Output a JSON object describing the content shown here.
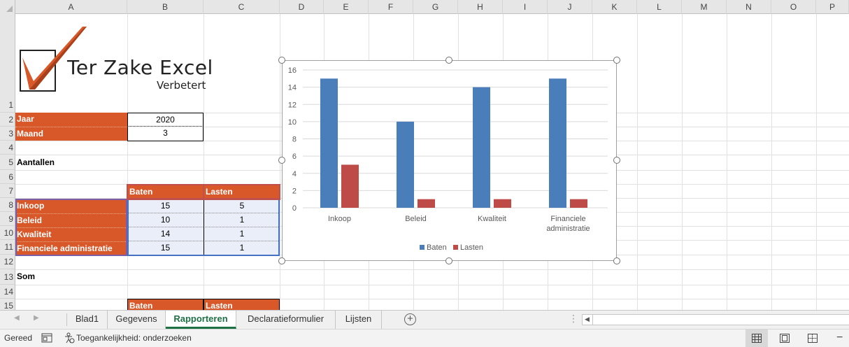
{
  "columns": [
    "A",
    "B",
    "C",
    "D",
    "E",
    "F",
    "G",
    "H",
    "I",
    "J",
    "K",
    "L",
    "M",
    "N",
    "O",
    "P"
  ],
  "rows": [
    "1",
    "2",
    "3",
    "4",
    "5",
    "6",
    "7",
    "8",
    "9",
    "10",
    "11",
    "12",
    "13",
    "14",
    "15"
  ],
  "logo": {
    "title": "Ter Zake Excel",
    "subtitle": "Verbetert"
  },
  "cells": {
    "jaar_label": "Jaar",
    "jaar_value": "2020",
    "maand_label": "Maand",
    "maand_value": "3",
    "aantallen": "Aantallen",
    "header_baten": "Baten",
    "header_lasten": "Lasten",
    "table": [
      {
        "label": "Inkoop",
        "baten": "15",
        "lasten": "5"
      },
      {
        "label": "Beleid",
        "baten": "10",
        "lasten": "1"
      },
      {
        "label": "Kwaliteit",
        "baten": "14",
        "lasten": "1"
      },
      {
        "label": "Financiele administratie",
        "baten": "15",
        "lasten": "1"
      }
    ],
    "som": "Som",
    "header2_baten": "Baten",
    "header2_lasten": "Lasten"
  },
  "chart_data": {
    "type": "bar",
    "categories": [
      "Inkoop",
      "Beleid",
      "Kwaliteit",
      "Financiele administratie"
    ],
    "category_lines": [
      [
        "Inkoop"
      ],
      [
        "Beleid"
      ],
      [
        "Kwaliteit"
      ],
      [
        "Financiele",
        "administratie"
      ]
    ],
    "series": [
      {
        "name": "Baten",
        "values": [
          15,
          10,
          14,
          15
        ],
        "color": "#4a7ebb"
      },
      {
        "name": "Lasten",
        "values": [
          5,
          1,
          1,
          1
        ],
        "color": "#be4b48"
      }
    ],
    "ylim": [
      0,
      16
    ],
    "yticks": [
      "0",
      "2",
      "4",
      "6",
      "8",
      "10",
      "12",
      "14",
      "16"
    ],
    "grid": true,
    "legend": "bottom"
  },
  "tabs": [
    "Blad1",
    "Gegevens",
    "Rapporteren",
    "Declaratieformulier",
    "Lijsten"
  ],
  "active_tab": "Rapporteren",
  "status": {
    "ready": "Gereed",
    "accessibility": "Toegankelijkheid: onderzoeken"
  },
  "colors": {
    "orange": "#d8582a",
    "excel_green": "#1e7145"
  }
}
